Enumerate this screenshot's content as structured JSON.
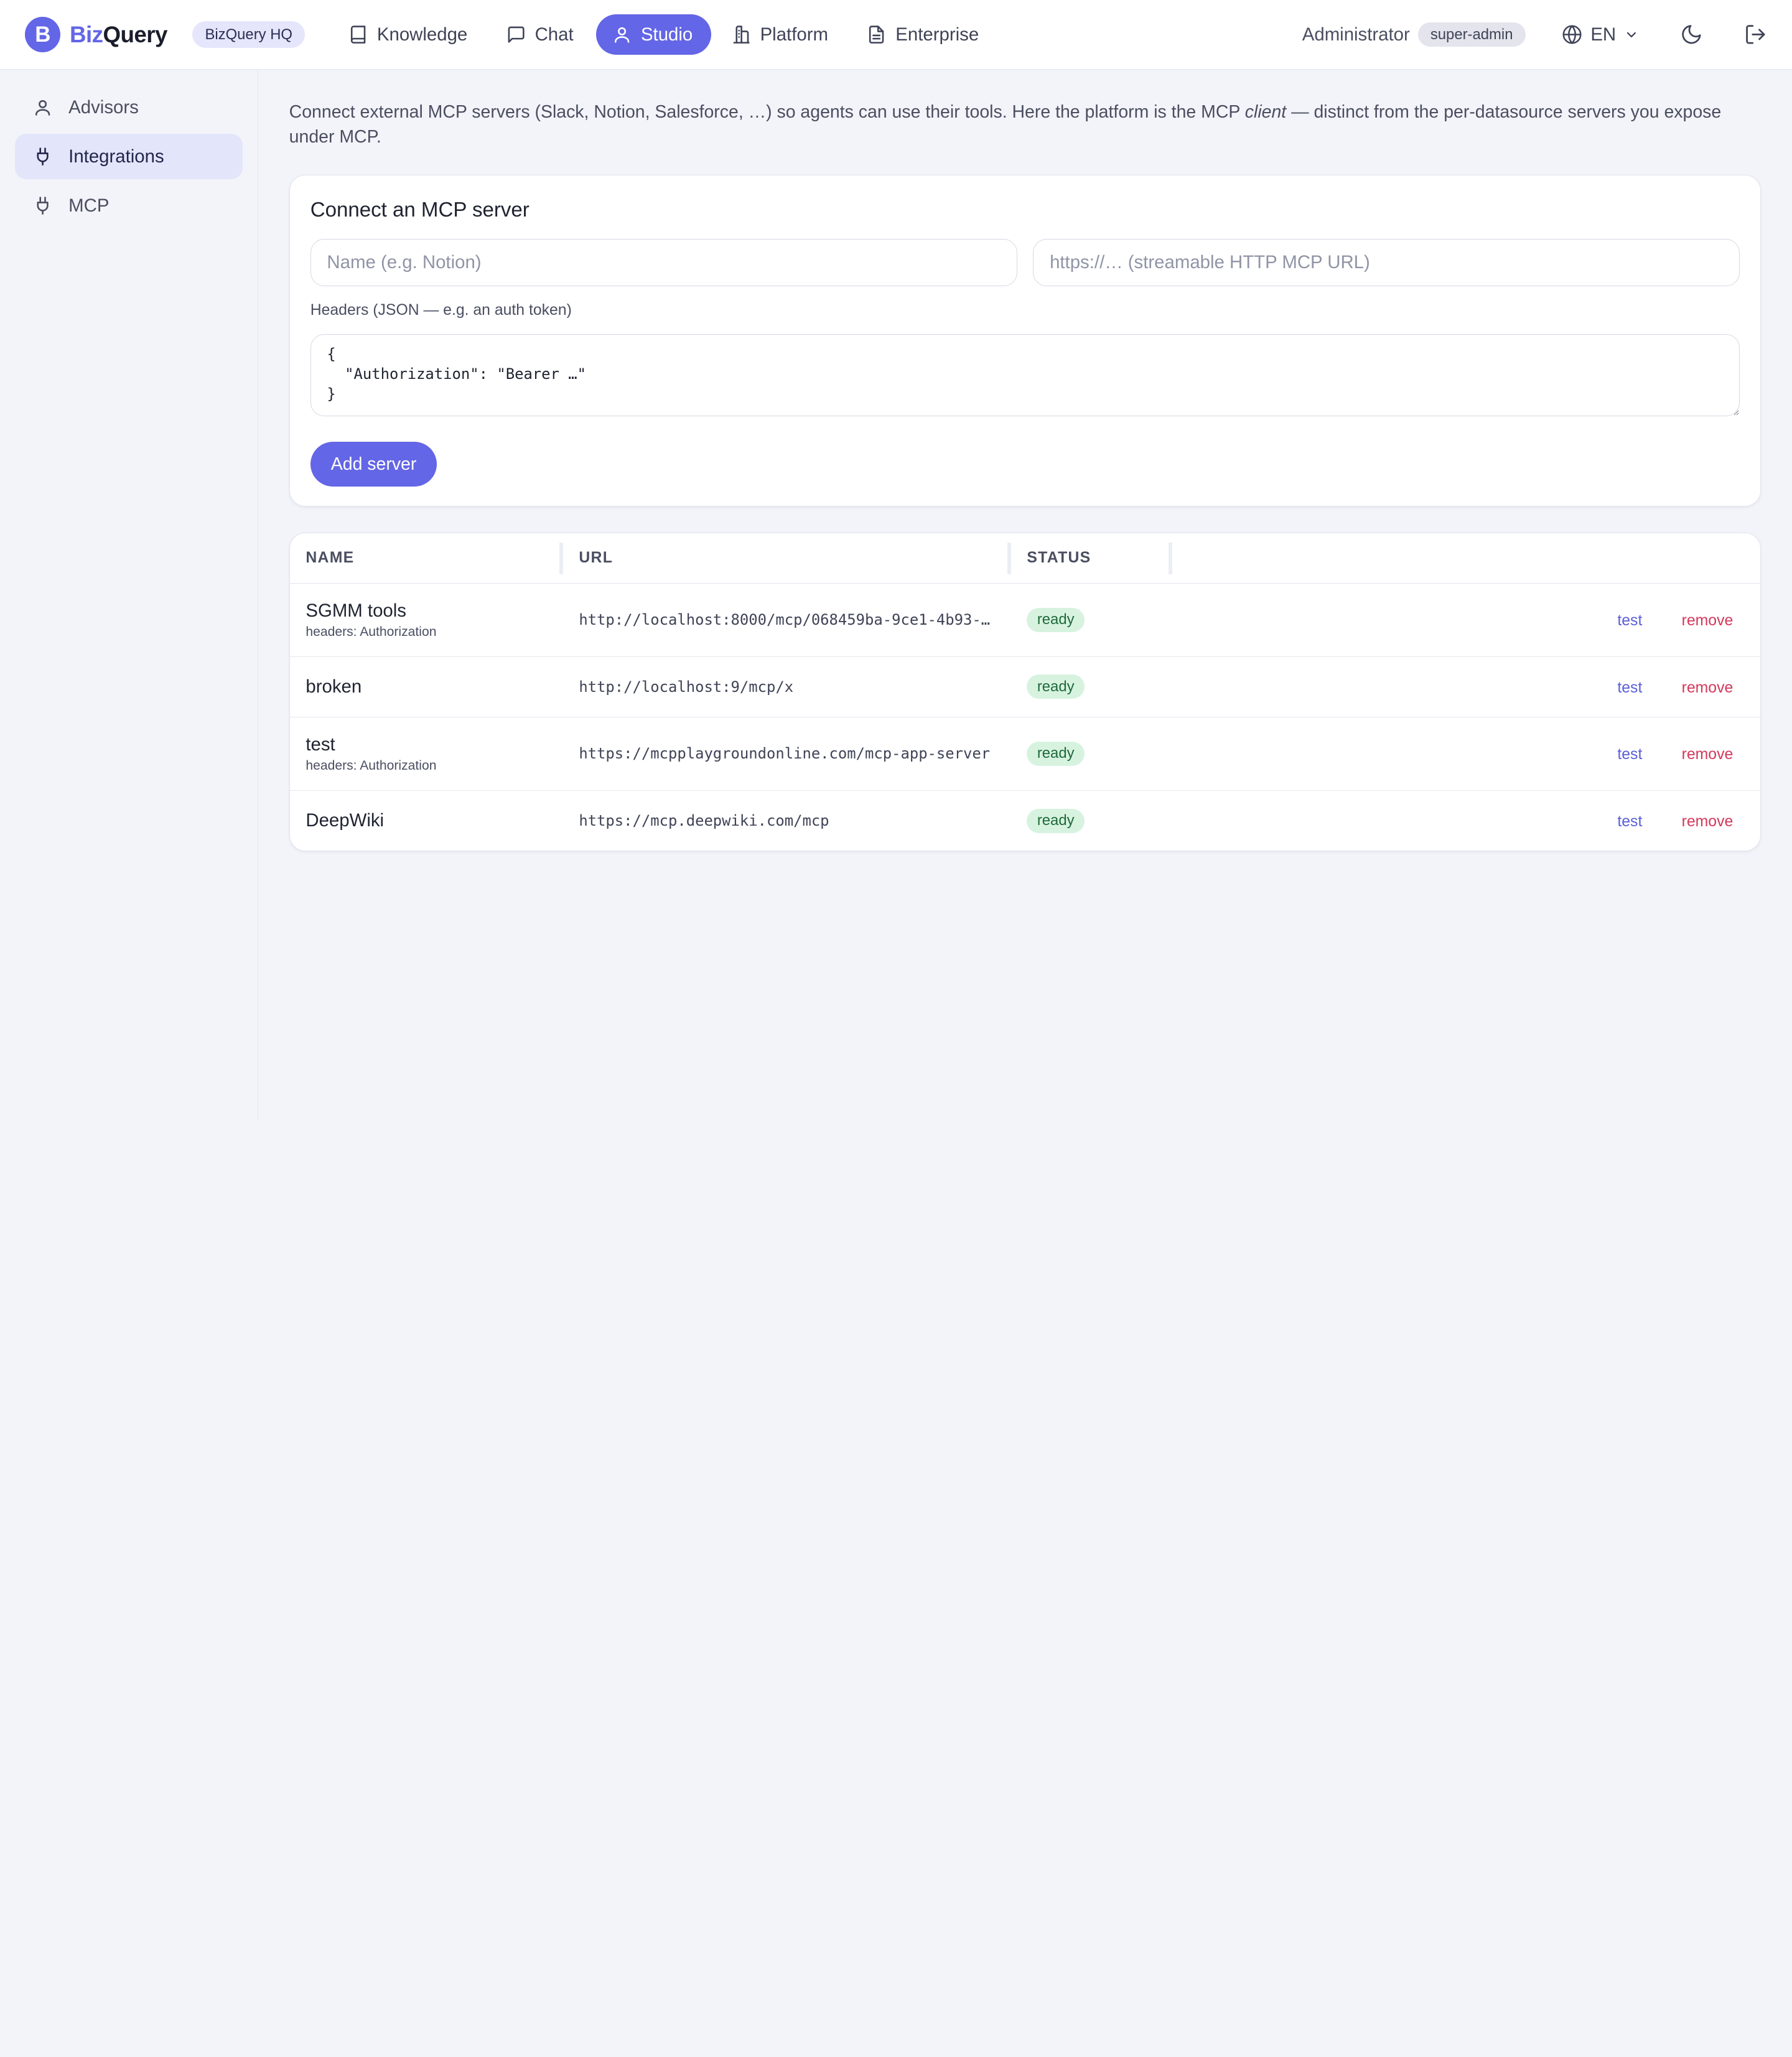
{
  "brand": {
    "logo_letter": "B",
    "name_part1": "Biz",
    "name_part2": "Query",
    "org": "BizQuery HQ"
  },
  "nav": [
    {
      "label": "Knowledge",
      "icon": "book-icon",
      "active": false
    },
    {
      "label": "Chat",
      "icon": "chat-icon",
      "active": false
    },
    {
      "label": "Studio",
      "icon": "user-icon",
      "active": true
    },
    {
      "label": "Platform",
      "icon": "building-icon",
      "active": false
    },
    {
      "label": "Enterprise",
      "icon": "document-icon",
      "active": false
    }
  ],
  "user": {
    "name": "Administrator",
    "role": "super-admin"
  },
  "language": {
    "code": "EN"
  },
  "sidebar": {
    "items": [
      {
        "label": "Advisors",
        "icon": "user-icon",
        "active": false
      },
      {
        "label": "Integrations",
        "icon": "plug-icon",
        "active": true
      },
      {
        "label": "MCP",
        "icon": "plug-icon",
        "active": false
      }
    ]
  },
  "intro": {
    "before": "Connect external MCP servers (Slack, Notion, Salesforce, …) so agents can use their tools. Here the platform is the MCP ",
    "emphasis": "client",
    "after": " — distinct from the per-datasource servers you expose under MCP."
  },
  "connect": {
    "title": "Connect an MCP server",
    "name_placeholder": "Name (e.g. Notion)",
    "url_placeholder": "https://… (streamable HTTP MCP URL)",
    "headers_label": "Headers (JSON — e.g. an auth token)",
    "headers_placeholder": "{\n  \"Authorization\": \"Bearer …\"\n}",
    "add_button": "Add server"
  },
  "table": {
    "columns": [
      "NAME",
      "URL",
      "STATUS"
    ],
    "rows": [
      {
        "name": "SGMM tools",
        "sub": "headers: Authorization",
        "url": "http://localhost:8000/mcp/068459ba-9ce1-4b93-…",
        "status": "ready",
        "test": "test",
        "remove": "remove"
      },
      {
        "name": "broken",
        "sub": "",
        "url": "http://localhost:9/mcp/x",
        "status": "ready",
        "test": "test",
        "remove": "remove"
      },
      {
        "name": "test",
        "sub": "headers: Authorization",
        "url": "https://mcpplaygroundonline.com/mcp-app-server",
        "status": "ready",
        "test": "test",
        "remove": "remove"
      },
      {
        "name": "DeepWiki",
        "sub": "",
        "url": "https://mcp.deepwiki.com/mcp",
        "status": "ready",
        "test": "test",
        "remove": "remove"
      }
    ]
  },
  "colors": {
    "accent": "#6366e6",
    "danger": "#d4385b",
    "ready_bg": "#d7f3e0",
    "ready_fg": "#1f6a3a"
  }
}
